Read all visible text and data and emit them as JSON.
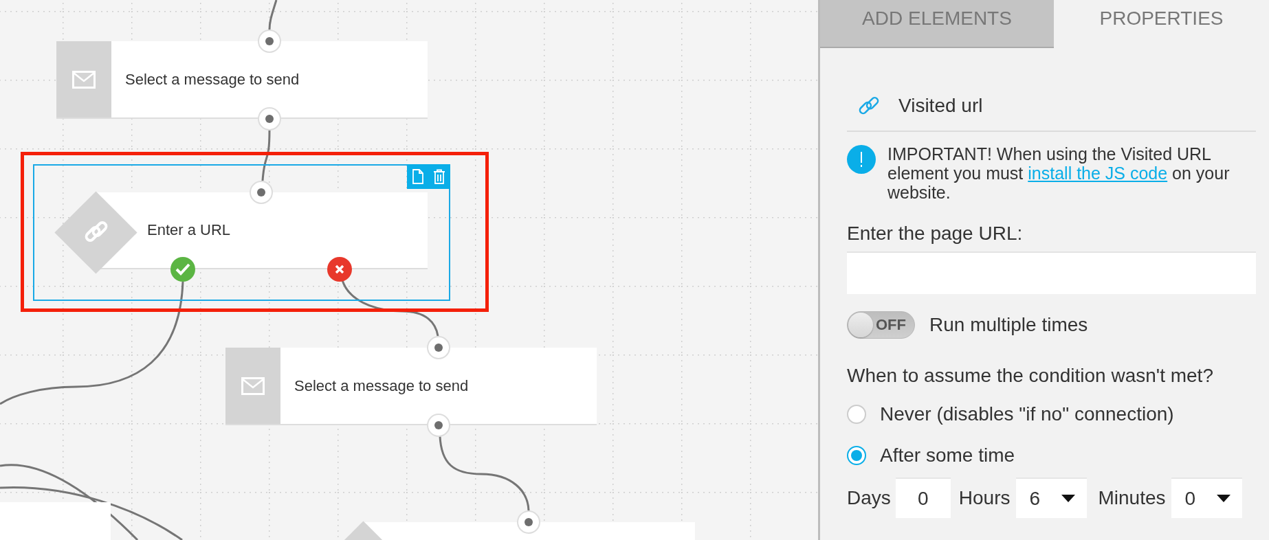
{
  "canvas": {
    "nodes": [
      {
        "kind": "message",
        "label": "Select a message to send",
        "selected": false,
        "highlighted": false
      },
      {
        "kind": "condition",
        "label": "Enter a URL",
        "selected": true,
        "highlighted": true
      },
      {
        "kind": "message",
        "label": "Select a message to send",
        "selected": false,
        "highlighted": false
      },
      {
        "kind": "message",
        "selected": false,
        "highlighted": false
      },
      {
        "kind": "condition",
        "selected": false,
        "highlighted": false
      }
    ]
  },
  "panel": {
    "tabs": [
      {
        "label": "ADD ELEMENTS",
        "selected": false
      },
      {
        "label": "PROPERTIES",
        "selected": true
      }
    ],
    "element_title": "Visited url",
    "notice": {
      "text": "IMPORTANT! When using the Visited URL element you must ",
      "link": "install the JS code",
      "text_after": " on your website."
    },
    "url_field": {
      "label": "Enter the page URL:"
    },
    "toggle": {
      "state_label": "OFF",
      "on": false,
      "label": "Run multiple times"
    },
    "question": "When to assume the condition wasn't met?",
    "options": [
      {
        "label": "Never (disables \"if no\" connection)",
        "selected": false
      },
      {
        "label": "After some time",
        "selected": true
      }
    ],
    "delay": {
      "days_label": "Days",
      "days": "0",
      "hours_label": "Hours",
      "hours": "6",
      "minutes_label": "Minutes",
      "minutes": "0"
    }
  }
}
